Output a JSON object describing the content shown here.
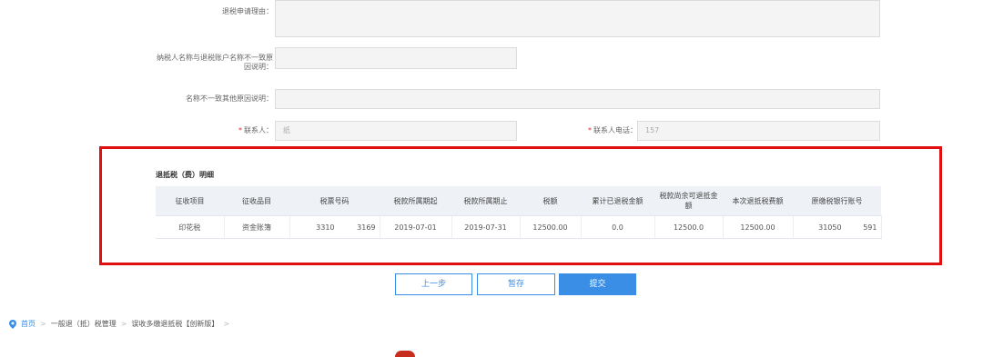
{
  "form": {
    "refund_reason_label": "退税申请理由：",
    "name_mismatch_label_line1": "纳税人名称与退税账户名称不一致原",
    "name_mismatch_label_line2": "因说明：",
    "other_reason_label": "名称不一致其他原因说明：",
    "contact_label": "联系人：",
    "contact_value": "纸",
    "contact_phone_label": "联系人电话：",
    "contact_phone_value": "157",
    "required_mark": "*"
  },
  "detail": {
    "title": "退抵税（费）明细",
    "columns": [
      "征收项目",
      "征收品目",
      "税票号码",
      "税款所属期起",
      "税款所属期止",
      "税额",
      "累计已退税金额",
      "税款尚余可退抵金额",
      "本次退抵税费额",
      "原缴税银行账号"
    ],
    "rows": [
      {
        "item": "印花税",
        "sub_item": "资金账簿",
        "ticket_no_a": "3310",
        "ticket_no_b": "3169",
        "period_start": "2019-07-01",
        "period_end": "2019-07-31",
        "tax_amount": "12500.00",
        "refunded_total": "0.0",
        "remaining": "12500.0",
        "current_refund": "12500.00",
        "account_a": "31050",
        "account_b": "591"
      }
    ]
  },
  "buttons": {
    "prev": "上一步",
    "save": "暂存",
    "submit": "提交"
  },
  "breadcrumb": {
    "home_icon": "location-pin-icon",
    "items": [
      "首页",
      "一般退（抵）税管理",
      "误收多缴退抵税【创新版】"
    ],
    "separator": ">"
  },
  "colors": {
    "accent": "#3a8ee6",
    "highlight_border": "#e01010"
  }
}
